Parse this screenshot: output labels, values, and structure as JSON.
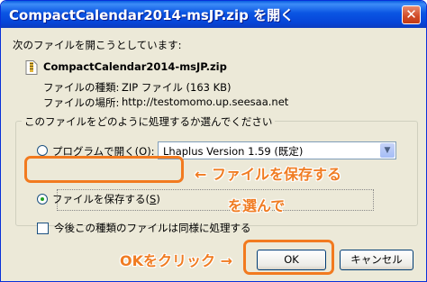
{
  "window": {
    "title": "CompactCalendar2014-msJP.zip を開く",
    "close_glyph": "✕"
  },
  "dialog": {
    "intro": "次のファイルを開こうとしています:",
    "file_name": "CompactCalendar2014-msJP.zip",
    "file_type_label": "ファイルの種類:",
    "file_type_value": "ZIP ファイル (163 KB)",
    "file_location_label": "ファイルの場所:",
    "file_location_value": "http://testomomo.up.seesaa.net",
    "group_title": "このファイルをどのように処理するか選んでください",
    "open_with_label": "プログラムで開く(O):",
    "open_with_value": "Lhaplus Version 1.59 (既定)",
    "save_label_prefix": "ファイルを保存する(",
    "save_label_key": "S",
    "save_label_suffix": ")",
    "remember_label": "今後この種類のファイルは同様に処理する",
    "ok_label": "OK",
    "cancel_label": "キャンセル"
  },
  "annotations": {
    "save_note": "← ファイルを保存する",
    "choose_note": "を選んで",
    "ok_note": "OKをクリック →"
  },
  "colors": {
    "title_bar": "#0a55e3",
    "annotation": "#f07c22",
    "window_bg": "#ece9d8"
  }
}
